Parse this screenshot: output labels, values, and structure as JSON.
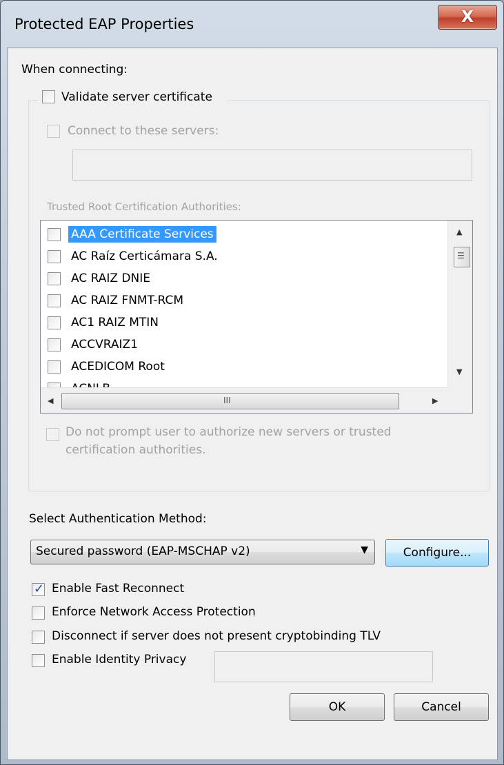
{
  "window": {
    "title": "Protected EAP Properties",
    "close_glyph": "X"
  },
  "when_connecting": "When connecting:",
  "validate_cert": {
    "label": "Validate server certificate",
    "checked": false
  },
  "connect_servers": {
    "label": "Connect to these servers:",
    "checked": false,
    "value": ""
  },
  "trusted_root": {
    "label": "Trusted Root Certification Authorities:",
    "items": [
      {
        "label": "AAA Certificate Services",
        "checked": false,
        "selected": true
      },
      {
        "label": "AC Raíz Certicámara S.A.",
        "checked": false
      },
      {
        "label": "AC RAIZ DNIE",
        "checked": false
      },
      {
        "label": "AC RAIZ FNMT-RCM",
        "checked": false
      },
      {
        "label": "AC1 RAIZ MTIN",
        "checked": false
      },
      {
        "label": "ACCVRAIZ1",
        "checked": false
      },
      {
        "label": "ACEDICOM Root",
        "checked": false
      },
      {
        "label": "ACNLB",
        "checked": false
      }
    ]
  },
  "scrollbar": {
    "up": "▲",
    "down": "▼",
    "left": "◀",
    "right": "▶",
    "grip_v": "☰",
    "grip_h": "III"
  },
  "no_prompt": {
    "label_line1": "Do not prompt user to authorize new servers or trusted",
    "label_line2": "certification authorities.",
    "checked": false
  },
  "auth_method": {
    "label": "Select Authentication Method:",
    "selected": "Secured password (EAP-MSCHAP v2)",
    "dropdown_glyph": "▼"
  },
  "configure_button": "Configure...",
  "options": {
    "fast_reconnect": {
      "label": "Enable Fast Reconnect",
      "checked": true
    },
    "nap": {
      "label": "Enforce Network Access Protection",
      "checked": false
    },
    "cryptobinding": {
      "label": "Disconnect if server does not present cryptobinding TLV",
      "checked": false
    },
    "identity_privacy": {
      "label": "Enable Identity Privacy",
      "checked": false,
      "value": ""
    }
  },
  "checkmark": "✓",
  "buttons": {
    "ok": "OK",
    "cancel": "Cancel"
  }
}
